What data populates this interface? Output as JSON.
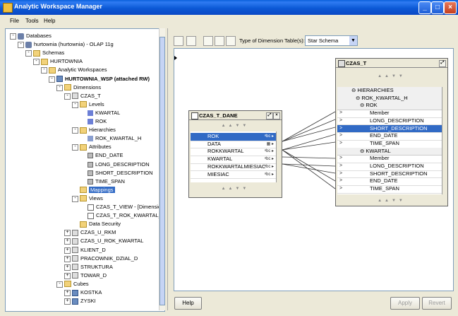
{
  "window": {
    "title": "Analytic Workspace Manager"
  },
  "menu": [
    "File",
    "Tools",
    "Help"
  ],
  "tree": [
    {
      "label": "Databases"
    },
    {
      "label": "hurtownia (hurtownia) - OLAP 11g"
    },
    {
      "label": "Schemas"
    },
    {
      "label": "HURTOWNIA"
    },
    {
      "label": "Analytic Workspaces"
    },
    {
      "label": "HURTOWNIA_WSP (attached RW)"
    },
    {
      "label": "Dimensions"
    },
    {
      "label": "CZAS_T"
    },
    {
      "label": "Levels"
    },
    {
      "label": "KWARTAL"
    },
    {
      "label": "ROK"
    },
    {
      "label": "Hierarchies"
    },
    {
      "label": "ROK_KWARTAL_H"
    },
    {
      "label": "Attributes"
    },
    {
      "label": "END_DATE"
    },
    {
      "label": "LONG_DESCRIPTION"
    },
    {
      "label": "SHORT_DESCRIPTION"
    },
    {
      "label": "TIME_SPAN"
    },
    {
      "label": "Mappings"
    },
    {
      "label": "Views"
    },
    {
      "label": "CZAS_T_VIEW - [Dimension]"
    },
    {
      "label": "CZAS_T_ROK_KWARTAL_H"
    },
    {
      "label": "Data Security"
    },
    {
      "label": "CZAS_U_RKM"
    },
    {
      "label": "CZAS_U_ROK_KWARTAL"
    },
    {
      "label": "KLIENT_D"
    },
    {
      "label": "PRACOWNIK_DZIAL_D"
    },
    {
      "label": "STRUKTURA"
    },
    {
      "label": "TOWAR_D"
    },
    {
      "label": "Cubes"
    },
    {
      "label": "KOSTKA"
    },
    {
      "label": "ZYSKI"
    }
  ],
  "toolbar": {
    "dim_table_label": "Type of Dimension Table(s):",
    "dim_table_value": "Star Schema"
  },
  "source_table": {
    "name": "CZAS_T_DANE",
    "columns": [
      {
        "name": "ROK",
        "type": "abc"
      },
      {
        "name": "DATA",
        "type": "date"
      },
      {
        "name": "ROKKWARTAL",
        "type": "abc"
      },
      {
        "name": "KWARTAL",
        "type": "abc"
      },
      {
        "name": "ROKKWARTALMIESIAC",
        "type": "abc"
      },
      {
        "name": "MIESIAC",
        "type": "abc"
      }
    ]
  },
  "target_dim": {
    "name": "CZAS_T",
    "hierarchies_label": "HIERARCHIES",
    "hierarchy_name": "ROK_KWARTAL_H",
    "levels": [
      {
        "name": "ROK",
        "items": [
          "Member",
          "LONG_DESCRIPTION",
          "SHORT_DESCRIPTION",
          "END_DATE",
          "TIME_SPAN"
        ]
      },
      {
        "name": "KWARTAL",
        "items": [
          "Member",
          "LONG_DESCRIPTION",
          "SHORT_DESCRIPTION",
          "END_DATE",
          "TIME_SPAN"
        ]
      }
    ]
  },
  "buttons": {
    "help": "Help",
    "apply": "Apply",
    "revert": "Revert"
  }
}
